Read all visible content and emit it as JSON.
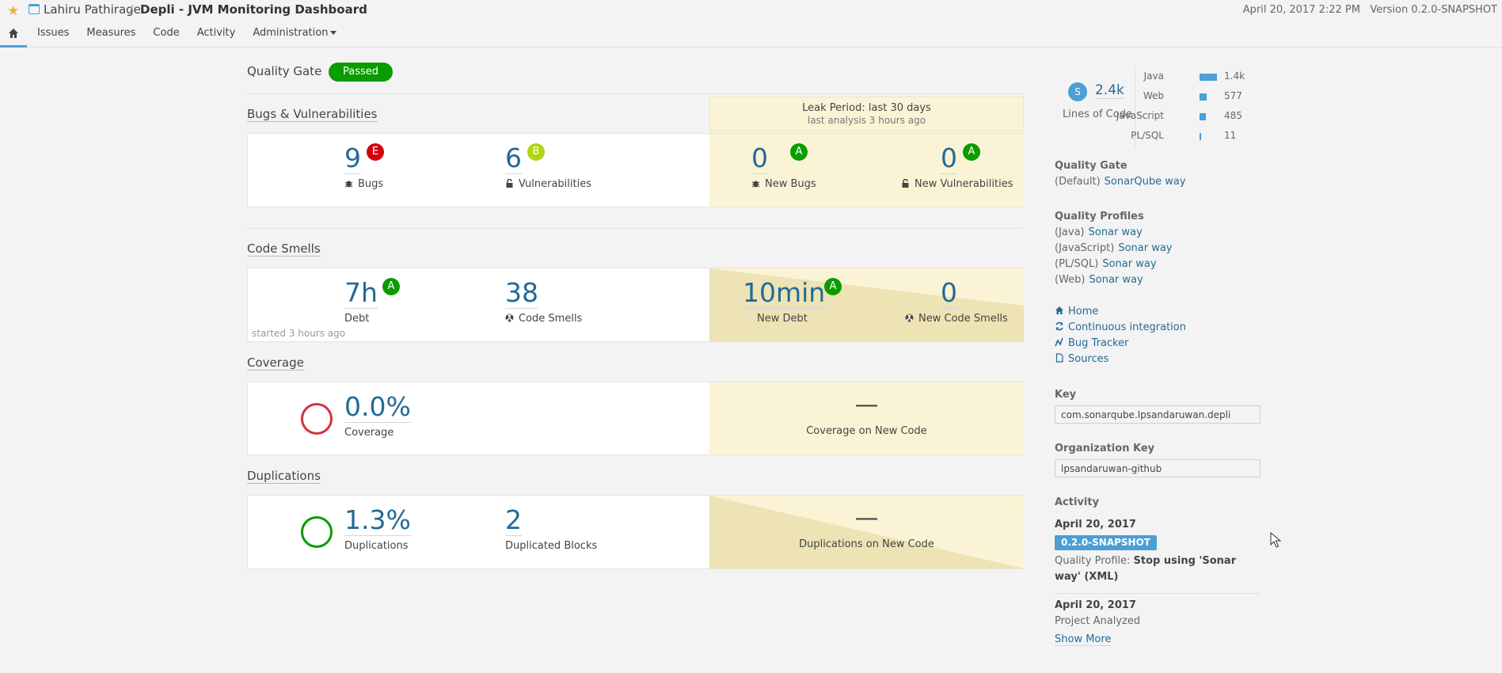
{
  "header": {
    "org": "Lahiru Pathirage",
    "separator": "/",
    "project": "Depli - JVM Monitoring Dashboard",
    "date": "April 20, 2017 2:22 PM",
    "version": "Version 0.2.0-SNAPSHOT"
  },
  "nav": [
    "Issues",
    "Measures",
    "Code",
    "Activity",
    "Administration"
  ],
  "quality_gate": {
    "label": "Quality Gate",
    "status": "Passed"
  },
  "leak_period": {
    "title": "Leak Period: last 30 days",
    "subtitle": "last analysis 3 hours ago"
  },
  "sections": {
    "bugs": "Bugs & Vulnerabilities",
    "smells": "Code Smells",
    "coverage": "Coverage",
    "duplications": "Duplications"
  },
  "bugs": {
    "bugs_value": "9",
    "bugs_rating": "E",
    "bugs_label": "Bugs",
    "vuln_value": "6",
    "vuln_rating": "B",
    "vuln_label": "Vulnerabilities",
    "new_bugs_value": "0",
    "new_bugs_rating": "A",
    "new_bugs_label": "New Bugs",
    "new_vuln_value": "0",
    "new_vuln_rating": "A",
    "new_vuln_label": "New Vulnerabilities"
  },
  "smells": {
    "debt_value": "7h",
    "debt_rating": "A",
    "debt_label": "Debt",
    "smells_value": "38",
    "smells_label": "Code Smells",
    "started": "started 3 hours ago",
    "new_debt_value": "10min",
    "new_debt_rating": "A",
    "new_debt_label": "New Debt",
    "new_smells_value": "0",
    "new_smells_label": "New Code Smells"
  },
  "coverage": {
    "value": "0.0%",
    "label": "Coverage",
    "new_value": "—",
    "new_label": "Coverage on New Code"
  },
  "duplications": {
    "value": "1.3%",
    "label": "Duplications",
    "blocks_value": "2",
    "blocks_label": "Duplicated Blocks",
    "new_value": "—",
    "new_label": "Duplications on New Code"
  },
  "sidebar": {
    "loc_badge": "S",
    "loc_value": "2.4k",
    "loc_label": "Lines of Code",
    "languages": [
      {
        "name": "Java",
        "value": "1.4k",
        "fraction": 1.0
      },
      {
        "name": "Web",
        "value": "577",
        "fraction": 0.41
      },
      {
        "name": "JavaScript",
        "value": "485",
        "fraction": 0.35
      },
      {
        "name": "PL/SQL",
        "value": "11",
        "fraction": 0.01
      }
    ],
    "quality_gate_title": "Quality Gate",
    "quality_gate_default": "(Default)",
    "quality_gate_link": "SonarQube way",
    "profiles_title": "Quality Profiles",
    "profiles": [
      {
        "lang": "(Java)",
        "link": "Sonar way"
      },
      {
        "lang": "(JavaScript)",
        "link": "Sonar way"
      },
      {
        "lang": "(PL/SQL)",
        "link": "Sonar way"
      },
      {
        "lang": "(Web)",
        "link": "Sonar way"
      }
    ],
    "links": [
      "Home",
      "Continuous integration",
      "Bug Tracker",
      "Sources"
    ],
    "key_title": "Key",
    "key_value": "com.sonarqube.lpsandaruwan.depli",
    "org_key_title": "Organization Key",
    "org_key_value": "lpsandaruwan-github",
    "activity_title": "Activity",
    "activity": [
      {
        "date": "April 20, 2017",
        "tag": "0.2.0-SNAPSHOT",
        "text_prefix": "Quality Profile:",
        "text_bold": "Stop using 'Sonar way' (XML)"
      },
      {
        "date": "April 20, 2017",
        "text": "Project Analyzed"
      }
    ],
    "show_more": "Show More"
  },
  "colors": {
    "accent": "#4b9fd5",
    "link": "#236a97",
    "passed": "#0a9c00",
    "leak": "#fbf3d5",
    "rating_e": "#d4000d",
    "rating_b": "#b0d513",
    "coverage_ring": "#d4333f",
    "duplication_ring": "#0a9c00"
  }
}
